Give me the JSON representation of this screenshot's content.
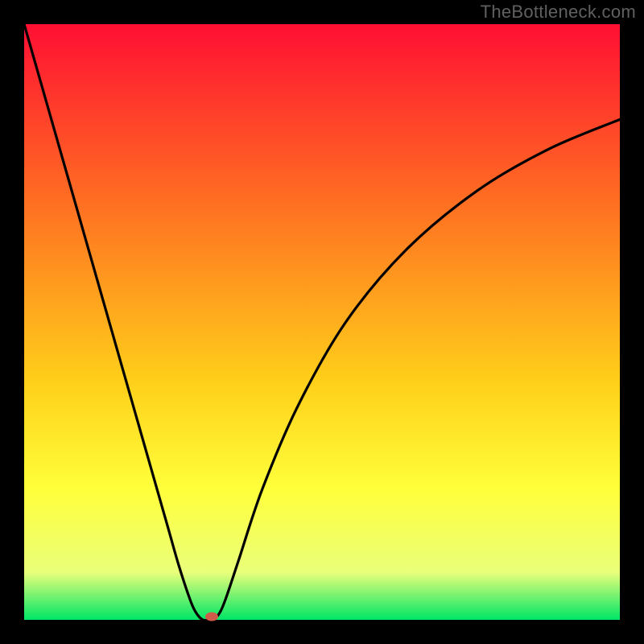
{
  "watermark": "TheBottleneck.com",
  "colors": {
    "frame": "#000000",
    "watermark": "#606060",
    "curve": "#000000",
    "dot": "#cf5a4a",
    "gradient_top": "#ff0f33",
    "gradient_mid1": "#ff6f22",
    "gradient_mid2": "#ffcf1a",
    "gradient_mid3": "#ffff3a",
    "gradient_mid4": "#eaff7a",
    "gradient_bottom": "#00e566"
  },
  "chart_data": {
    "type": "line",
    "title": "",
    "xlabel": "",
    "ylabel": "",
    "xlim": [
      0,
      100
    ],
    "ylim": [
      0,
      100
    ],
    "series": [
      {
        "name": "bottleneck-curve",
        "x": [
          0,
          4,
          8,
          12,
          16,
          20,
          24,
          26,
          28,
          29,
          30,
          31,
          32,
          33,
          34,
          36,
          40,
          46,
          54,
          64,
          76,
          88,
          100
        ],
        "y": [
          100,
          86,
          72,
          58,
          44,
          30,
          16,
          9,
          3,
          1,
          0,
          0,
          0.2,
          1.5,
          4,
          10,
          22,
          36,
          50,
          62,
          72,
          79,
          84
        ]
      }
    ],
    "marker": {
      "x": 31.5,
      "y": 0.5,
      "color": "#cf5a4a"
    },
    "background_gradient": {
      "stops": [
        {
          "pos": 0.0,
          "color": "#ff0f33"
        },
        {
          "pos": 0.3,
          "color": "#ff6f22"
        },
        {
          "pos": 0.6,
          "color": "#ffcf1a"
        },
        {
          "pos": 0.78,
          "color": "#ffff3a"
        },
        {
          "pos": 0.92,
          "color": "#eaff7a"
        },
        {
          "pos": 1.0,
          "color": "#00e566"
        }
      ]
    }
  }
}
